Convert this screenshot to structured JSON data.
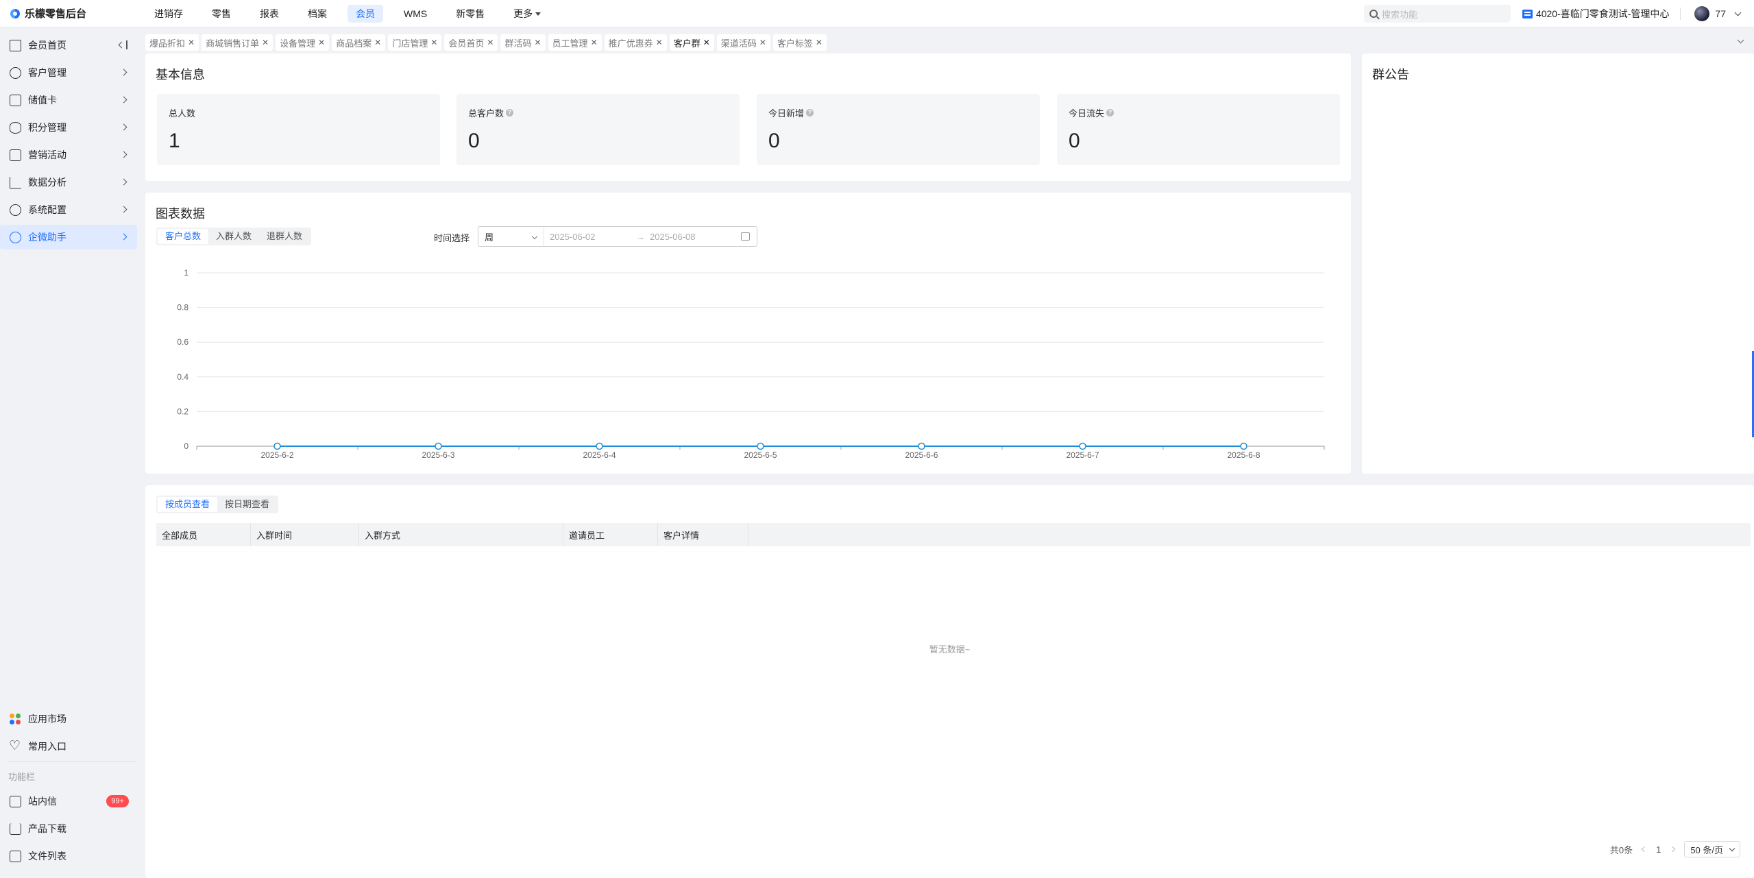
{
  "brand": {
    "name": "乐檬零售后台"
  },
  "nav": {
    "items": [
      "进销存",
      "零售",
      "报表",
      "档案",
      "会员",
      "WMS",
      "新零售",
      "更多"
    ],
    "active": 4
  },
  "search": {
    "placeholder": "搜索功能"
  },
  "store": {
    "name": "4020-喜临门零食测试-管理中心"
  },
  "user": {
    "name": "77"
  },
  "sidebar": {
    "items": [
      {
        "label": "会员首页",
        "icon": "home-icon"
      },
      {
        "label": "客户管理",
        "icon": "user-icon"
      },
      {
        "label": "储值卡",
        "icon": "card-icon"
      },
      {
        "label": "积分管理",
        "icon": "database-icon"
      },
      {
        "label": "营销活动",
        "icon": "campaign-icon"
      },
      {
        "label": "数据分析",
        "icon": "chart-icon"
      },
      {
        "label": "系统配置",
        "icon": "gear-icon"
      },
      {
        "label": "企微助手",
        "icon": "chat-icon"
      }
    ],
    "active": 7,
    "bottom_items": [
      {
        "label": "应用市场",
        "icon": "apps-icon"
      },
      {
        "label": "常用入口",
        "icon": "heart-icon"
      }
    ],
    "section_label": "功能栏",
    "section_items": [
      {
        "label": "站内信",
        "icon": "mail-icon",
        "badge": "99+"
      },
      {
        "label": "产品下载",
        "icon": "download-icon"
      },
      {
        "label": "文件列表",
        "icon": "file-list-icon"
      }
    ]
  },
  "tabs": {
    "items": [
      "爆品折扣",
      "商城销售订单",
      "设备管理",
      "商品档案",
      "门店管理",
      "会员首页",
      "群活码",
      "员工管理",
      "推广优惠券",
      "客户群",
      "渠道活码",
      "客户标签"
    ],
    "active": 9
  },
  "basic_info": {
    "title": "基本信息",
    "stats": [
      {
        "label": "总人数",
        "value": "1",
        "info": false
      },
      {
        "label": "总客户数",
        "value": "0",
        "info": true
      },
      {
        "label": "今日新增",
        "value": "0",
        "info": true
      },
      {
        "label": "今日流失",
        "value": "0",
        "info": true
      }
    ]
  },
  "announcement": {
    "title": "群公告"
  },
  "chart_section": {
    "title": "图表数据",
    "segments": [
      "客户总数",
      "入群人数",
      "退群人数"
    ],
    "active_segment": 0,
    "time_label": "时间选择",
    "period": "周",
    "date_start": "2025-06-02",
    "date_end": "2025-06-08",
    "arrow": "→"
  },
  "chart_data": {
    "type": "line",
    "x": [
      "2025-6-2",
      "2025-6-3",
      "2025-6-4",
      "2025-6-5",
      "2025-6-6",
      "2025-6-7",
      "2025-6-8"
    ],
    "series": [
      {
        "values": [
          0,
          0,
          0,
          0,
          0,
          0,
          0
        ]
      }
    ],
    "yticks": [
      "0",
      "0.2",
      "0.4",
      "0.6",
      "0.8",
      "1"
    ],
    "ylim": [
      0,
      1
    ],
    "grid": true,
    "line_color": "#1f8ed6"
  },
  "table": {
    "segments": [
      "按成员查看",
      "按日期查看"
    ],
    "active_segment": 0,
    "columns": [
      "全部成员",
      "入群时间",
      "入群方式",
      "邀请员工",
      "客户详情"
    ],
    "empty_text": "暂无数据~",
    "total": "共0条",
    "page": "1",
    "page_size": "50 条/页"
  },
  "colors": {
    "accent": "#1e6fff",
    "badge": "#ff4d4f"
  }
}
